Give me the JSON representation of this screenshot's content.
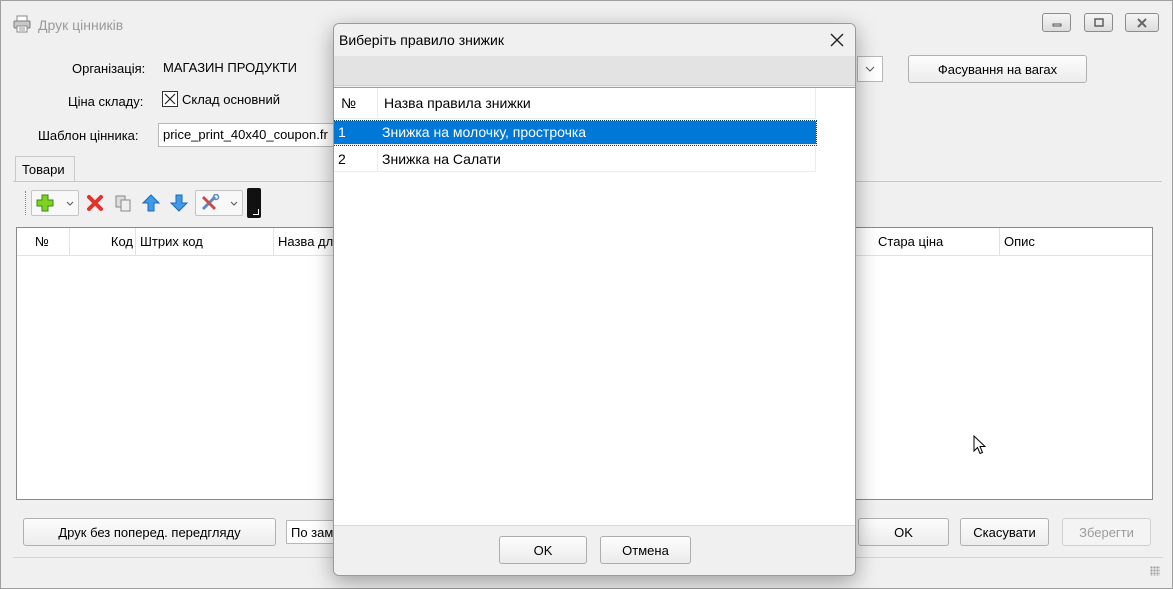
{
  "window": {
    "title": "Друк цінників",
    "min_icon": "minimize-icon",
    "max_icon": "maximize-icon",
    "close_icon": "close-icon"
  },
  "form": {
    "organization_label": "Організація:",
    "organization_value": "МАГАЗИН ПРОДУКТИ",
    "price_label": "Ціна складу:",
    "price_value": "Склад основний",
    "template_label": "Шаблон цінника:",
    "template_value": "price_print_40x40_coupon.fr",
    "weight_button": "Фасування на вагах"
  },
  "tabs": [
    {
      "label": "Товари"
    }
  ],
  "toolbar": {
    "icons": [
      "add-icon",
      "delete-icon",
      "copy-icon",
      "move-up-icon",
      "move-down-icon",
      "tools-icon",
      "barcode-scanner-icon"
    ]
  },
  "grid": {
    "columns": [
      "№",
      "Код",
      "Штрих код",
      "Назва дл",
      "Стара ціна",
      "Опис"
    ]
  },
  "bottom": {
    "print_button": "Друк без поперед. передгляду",
    "sort_value": "По зам",
    "ok_button": "OK",
    "cancel_button": "Скасувати",
    "save_button": "Зберегти"
  },
  "dialog": {
    "title": "Виберіть правило знижик",
    "columns": [
      "№",
      "Назва правила знижки"
    ],
    "rows": [
      {
        "num": "1",
        "name": "Знижка на молочку, прострочка",
        "selected": true
      },
      {
        "num": "2",
        "name": "Знижка на Салати",
        "selected": false
      }
    ],
    "ok_button": "OK",
    "cancel_button": "Отмена"
  },
  "colors": {
    "selection": "#0078d7",
    "window_bg": "#f0f0f0"
  }
}
